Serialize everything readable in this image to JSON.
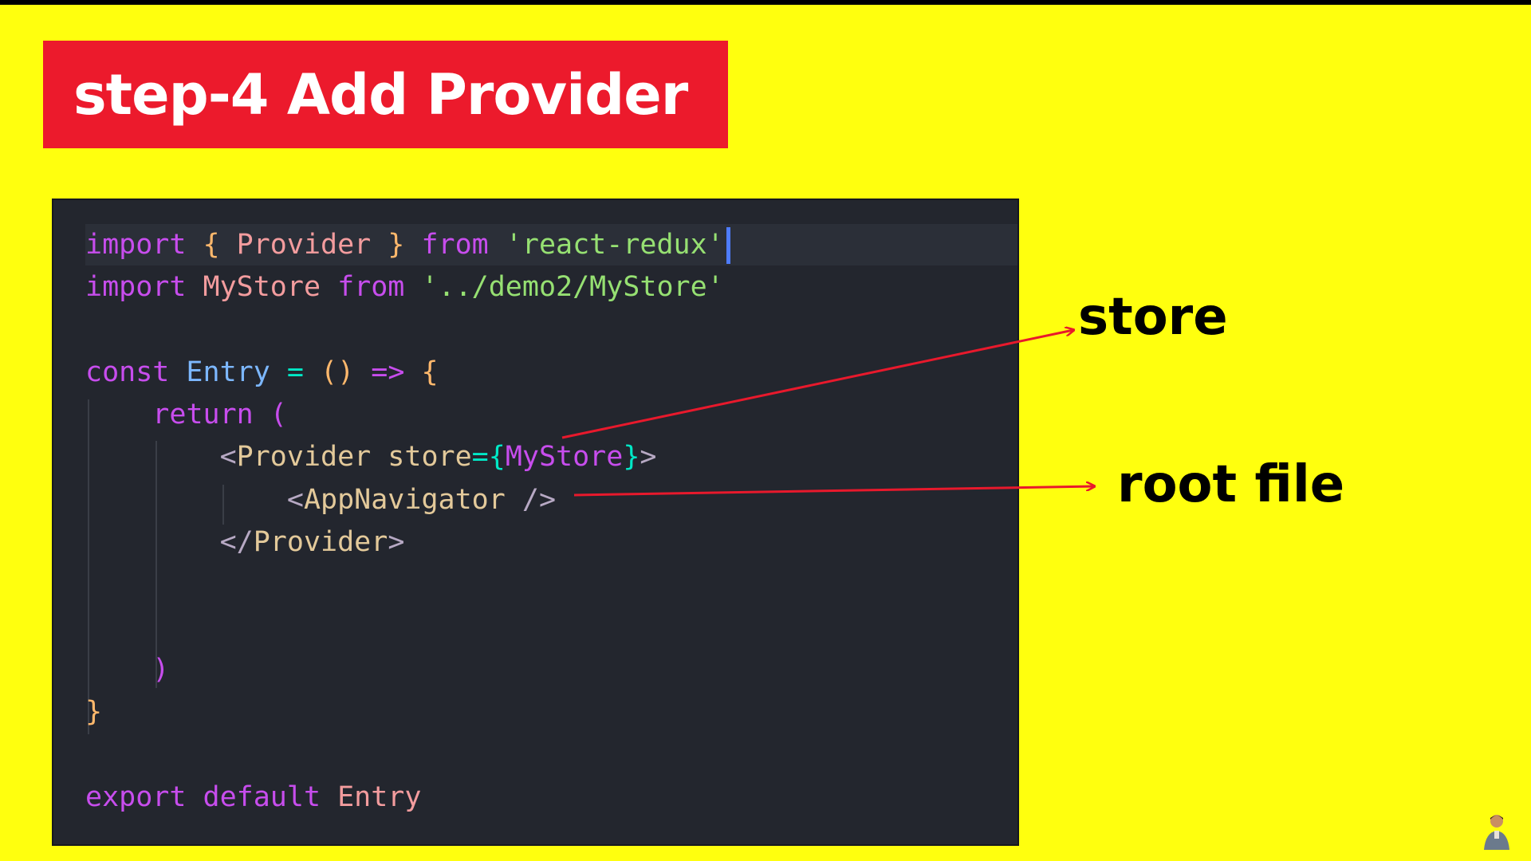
{
  "title": "step-4 Add Provider",
  "labels": {
    "store": "store",
    "root_file": "root file"
  },
  "code": {
    "line1": {
      "import": "import",
      "open": " { ",
      "provider": "Provider",
      "close": " } ",
      "from": "from",
      "module": " 'react-redux'"
    },
    "line2": {
      "import": "import",
      "mystore": " MyStore",
      "from": " from",
      "path": " '../demo2/MyStore'"
    },
    "line4": {
      "const": "const",
      "entry": " Entry",
      "eq": " =",
      "parens": " ()",
      "arrow": " =>",
      "brace": " {"
    },
    "line5": {
      "return": "return",
      "paren": " ("
    },
    "line6": {
      "lt": "<",
      "tag": "Provider",
      "attr": " store",
      "eq": "=",
      "lbrace": "{",
      "value": "MyStore",
      "rbrace": "}",
      "gt": ">"
    },
    "line7": {
      "lt": "<",
      "tag": "AppNavigator",
      "end": " />"
    },
    "line8": {
      "lt": "</",
      "tag": "Provider",
      "gt": ">"
    },
    "line11": ")",
    "line12": "}",
    "line14": {
      "export": "export",
      "default": " default",
      "entry": " Entry"
    }
  },
  "colors": {
    "background": "#ffff0e",
    "banner": "#ec1a2c",
    "editor": "#23262e",
    "arrow": "#e8192c"
  },
  "icons": {
    "avatar": "person-avatar-icon"
  }
}
